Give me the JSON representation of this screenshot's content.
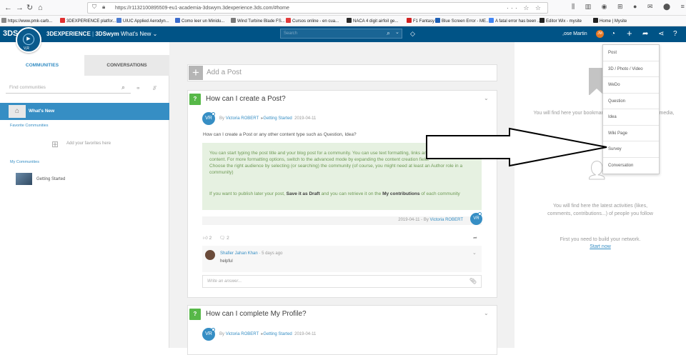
{
  "browser": {
    "url": "https://r1132100895509-eu1-academia-3dswym.3dexperience.3ds.com/#home",
    "bookmarks": [
      "https://www.pmk-carb...",
      "3DEXPERIENCE platfor...",
      "UIUC Applied Aerodyn...",
      "Como leer un Minidu...",
      "Wind Turbine Blade FS...",
      "Cursos online - en cua...",
      "NACA 4 digit airfoil ge...",
      "F1 Fantasy",
      "Blue Screen Error - ME...",
      "A fatal error has been ...",
      "Editor Wix - mysite",
      "Home | Mysite"
    ],
    "bookmark_colors": [
      "#888888",
      "#e03030",
      "#4a7bd0",
      "#3b6bcc",
      "#7a7a7a",
      "#e23a3a",
      "#2a2a2a",
      "#d12020",
      "#1e5fb4",
      "#4285f4",
      "#222222",
      "#222222"
    ]
  },
  "header": {
    "logo_text": "3DS",
    "compass_label": "V,R",
    "brand_bold": "3DEXPERIENCE",
    "brand_app": "3DSwym",
    "brand_menu": "What's New",
    "search_placeholder": "Search",
    "user_name": ",ose Martin",
    "user_initials": "JM"
  },
  "sidebar": {
    "tab_communities": "COMMUNITIES",
    "tab_conversations": "CONVERSATIONS",
    "find_placeholder": "Find communities",
    "whats_new": "What's New",
    "favorite_heading": "Favorite Communities",
    "favorite_empty": "Add your favorites here",
    "my_communities_heading": "My Communities",
    "my_communities": [
      "Getting Started"
    ]
  },
  "feed": {
    "add_post": "Add a Post",
    "posts": [
      {
        "title": "How can I create a Post?",
        "author_initials": "VR",
        "by": "By",
        "author": "Victoria ROBERT",
        "community": "Getting Started",
        "date": "2019-04-11",
        "intro": "How can I create a Post or any other content type such as Question, Idea?",
        "body_p1": "You can start typing the post title and your blog post for a community. You can use text formatting, links and attach medias to your content. For more formatting options, switch to the advanced mode by expanding the content creation field.\nChoose the right audience by selecting (or searching) the community (of course, you might need at least an Author role in a community)",
        "body_p2_a": "If you want to publish later your post, ",
        "body_p2_b": "Save it as Draft",
        "body_p2_c": " and you can retrieve it on the ",
        "body_p2_d": "My contributions",
        "body_p2_e": " of each community",
        "footer_date": "2019-04-11",
        "footer_by": "By",
        "footer_author": "Victoria ROBERT",
        "likes": "2",
        "comments": "2",
        "comment_author": "Shafier Jahan Khan",
        "comment_time": "5 days ago",
        "comment_text": "helpful",
        "answer_placeholder": "Write an answer..."
      },
      {
        "title": "How can I complete My Profile?",
        "author_initials": "VR",
        "by": "By",
        "author": "Victoria ROBERT",
        "community": "Getting Started",
        "date": "2019-04-11"
      }
    ]
  },
  "right_panel": {
    "text1": "You will find here your bookmarked Post, idea, question, media,",
    "text1_tail": "d,",
    "text2": "You will find here the latest activities (likes, comments, contributions...) of people you follow",
    "text3": "First you need to build your network.",
    "start_now": "Start now"
  },
  "dropdown": {
    "items": [
      "Post",
      "3D / Photo / Video",
      "WeDo",
      "Question",
      "Idea",
      "Wiki Page",
      "Survey",
      "Conversation"
    ]
  },
  "colors": {
    "header_bg": "#005386",
    "accent": "#368ec4",
    "question_green": "#57b848",
    "highlight_bg": "#e6f1e1"
  }
}
